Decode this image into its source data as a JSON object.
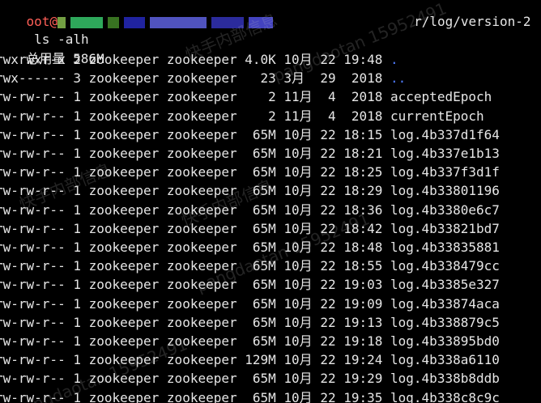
{
  "prompt": {
    "user": "oot@",
    "path_tail": "r/log/version-2",
    "blur_colors": [
      "#9ad65a",
      "#3ee07a",
      "#4b9a2c",
      "#2b2fd6",
      "#6b6fff",
      "#3a3ad0",
      "#5a5aff"
    ]
  },
  "command": " ls -alh",
  "total": "总用量 586M",
  "rows": [
    {
      "perm": "rwxrwxr-x",
      "links": "2",
      "user": "zookeeper",
      "group": "zookeeper",
      "size": "4.0K",
      "month": "10月",
      "day": "22",
      "time": "19:48",
      "name": ".",
      "is_dir": true
    },
    {
      "perm": "rwx------",
      "links": "3",
      "user": "zookeeper",
      "group": "zookeeper",
      "size": "23",
      "month": "3月",
      "day": "29",
      "time": "2018",
      "name": "..",
      "is_dir": true
    },
    {
      "perm": "rw-rw-r--",
      "links": "1",
      "user": "zookeeper",
      "group": "zookeeper",
      "size": "2",
      "month": "11月",
      "day": "4",
      "time": "2018",
      "name": "acceptedEpoch",
      "is_dir": false
    },
    {
      "perm": "rw-rw-r--",
      "links": "1",
      "user": "zookeeper",
      "group": "zookeeper",
      "size": "2",
      "month": "11月",
      "day": "4",
      "time": "2018",
      "name": "currentEpoch",
      "is_dir": false
    },
    {
      "perm": "rw-rw-r--",
      "links": "1",
      "user": "zookeeper",
      "group": "zookeeper",
      "size": "65M",
      "month": "10月",
      "day": "22",
      "time": "18:15",
      "name": "log.4b337d1f64",
      "is_dir": false
    },
    {
      "perm": "rw-rw-r--",
      "links": "1",
      "user": "zookeeper",
      "group": "zookeeper",
      "size": "65M",
      "month": "10月",
      "day": "22",
      "time": "18:21",
      "name": "log.4b337e1b13",
      "is_dir": false
    },
    {
      "perm": "rw-rw-r--",
      "links": "1",
      "user": "zookeeper",
      "group": "zookeeper",
      "size": "65M",
      "month": "10月",
      "day": "22",
      "time": "18:25",
      "name": "log.4b337f3d1f",
      "is_dir": false
    },
    {
      "perm": "rw-rw-r--",
      "links": "1",
      "user": "zookeeper",
      "group": "zookeeper",
      "size": "65M",
      "month": "10月",
      "day": "22",
      "time": "18:29",
      "name": "log.4b33801196",
      "is_dir": false
    },
    {
      "perm": "rw-rw-r--",
      "links": "1",
      "user": "zookeeper",
      "group": "zookeeper",
      "size": "65M",
      "month": "10月",
      "day": "22",
      "time": "18:36",
      "name": "log.4b3380e6c7",
      "is_dir": false
    },
    {
      "perm": "rw-rw-r--",
      "links": "1",
      "user": "zookeeper",
      "group": "zookeeper",
      "size": "65M",
      "month": "10月",
      "day": "22",
      "time": "18:42",
      "name": "log.4b33821bd7",
      "is_dir": false
    },
    {
      "perm": "rw-rw-r--",
      "links": "1",
      "user": "zookeeper",
      "group": "zookeeper",
      "size": "65M",
      "month": "10月",
      "day": "22",
      "time": "18:48",
      "name": "log.4b33835881",
      "is_dir": false
    },
    {
      "perm": "rw-rw-r--",
      "links": "1",
      "user": "zookeeper",
      "group": "zookeeper",
      "size": "65M",
      "month": "10月",
      "day": "22",
      "time": "18:55",
      "name": "log.4b338479cc",
      "is_dir": false
    },
    {
      "perm": "rw-rw-r--",
      "links": "1",
      "user": "zookeeper",
      "group": "zookeeper",
      "size": "65M",
      "month": "10月",
      "day": "22",
      "time": "19:03",
      "name": "log.4b3385e327",
      "is_dir": false
    },
    {
      "perm": "rw-rw-r--",
      "links": "1",
      "user": "zookeeper",
      "group": "zookeeper",
      "size": "65M",
      "month": "10月",
      "day": "22",
      "time": "19:09",
      "name": "log.4b33874aca",
      "is_dir": false
    },
    {
      "perm": "rw-rw-r--",
      "links": "1",
      "user": "zookeeper",
      "group": "zookeeper",
      "size": "65M",
      "month": "10月",
      "day": "22",
      "time": "19:13",
      "name": "log.4b338879c5",
      "is_dir": false
    },
    {
      "perm": "rw-rw-r--",
      "links": "1",
      "user": "zookeeper",
      "group": "zookeeper",
      "size": "65M",
      "month": "10月",
      "day": "22",
      "time": "19:18",
      "name": "log.4b33895bd0",
      "is_dir": false
    },
    {
      "perm": "rw-rw-r--",
      "links": "1",
      "user": "zookeeper",
      "group": "zookeeper",
      "size": "129M",
      "month": "10月",
      "day": "22",
      "time": "19:24",
      "name": "log.4b338a6110",
      "is_dir": false
    },
    {
      "perm": "rw-rw-r--",
      "links": "1",
      "user": "zookeeper",
      "group": "zookeeper",
      "size": "65M",
      "month": "10月",
      "day": "22",
      "time": "19:29",
      "name": "log.4b338b8ddb",
      "is_dir": false
    },
    {
      "perm": "rw-rw-r--",
      "links": "1",
      "user": "zookeeper",
      "group": "zookeeper",
      "size": "65M",
      "month": "10月",
      "day": "22",
      "time": "19:35",
      "name": "log.4b338c8c9c",
      "is_dir": false
    }
  ],
  "watermarks": [
    "快手内部信息",
    "pangdaotan 15952491",
    "快手内部信息",
    "pangdaotan 15952491",
    "快手内部信息",
    "pangdaotan 15952491"
  ],
  "colors": {
    "background": "#000000",
    "text": "#e6e6e6",
    "prompt_user": "#ff5f57",
    "directory": "#4f7cff"
  }
}
